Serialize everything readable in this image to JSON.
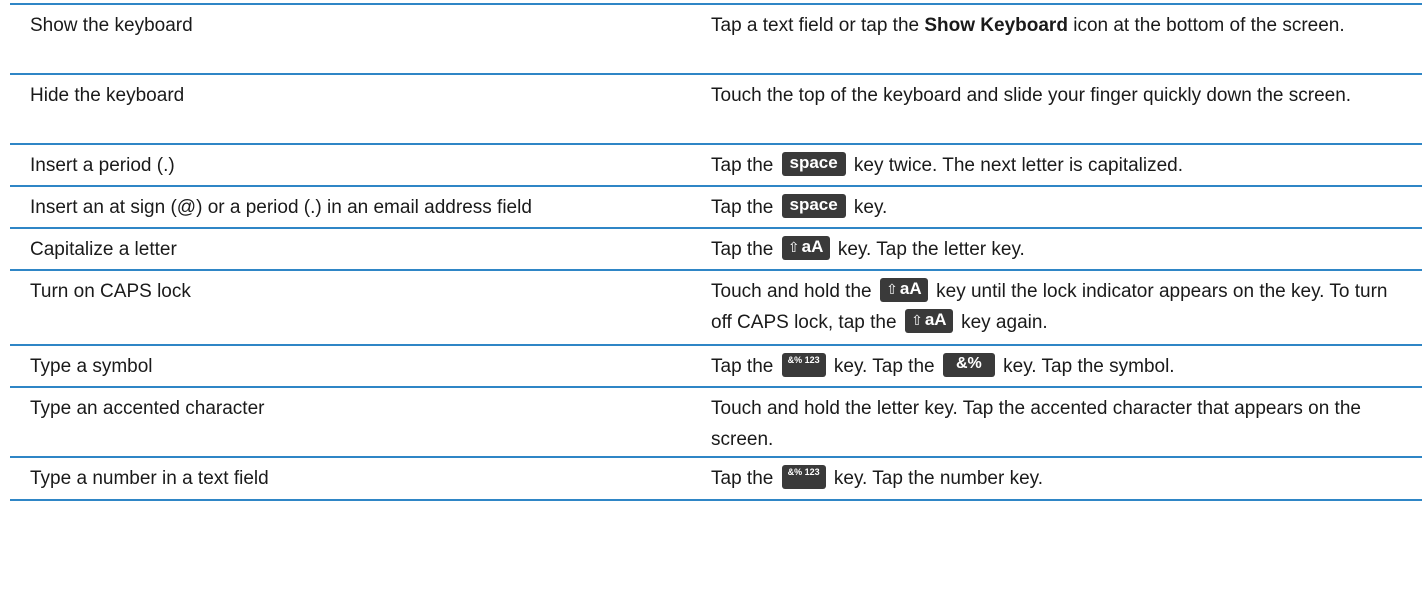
{
  "rows": [
    {
      "task": "Show the keyboard",
      "desc": {
        "a": "Tap a text field or tap the ",
        "b": "Show Keyboard",
        "c": " icon at the bottom of the screen."
      }
    },
    {
      "task": "Hide the keyboard",
      "desc": {
        "a": "Touch the top of the keyboard and slide your finger quickly down the screen."
      }
    },
    {
      "task": "Insert a period (.)",
      "desc": {
        "a": "Tap the ",
        "key": "space",
        "c": " key twice. The next letter is capitalized."
      }
    },
    {
      "task": "Insert an at sign (@) or a period (.) in an email address field",
      "desc": {
        "a": "Tap the ",
        "key": "space",
        "c": " key."
      }
    },
    {
      "task": "Capitalize a letter",
      "desc": {
        "a": "Tap the ",
        "key": "aA",
        "c": " key. Tap the letter key."
      }
    },
    {
      "task": "Turn on CAPS lock",
      "desc": {
        "a": "Touch and hold the ",
        "key": "aA",
        "c": " key until the lock indicator appears on the key. To turn off CAPS lock, tap the ",
        "key2": "aA",
        "e": " key again."
      }
    },
    {
      "task": "Type a symbol",
      "desc": {
        "a": "Tap the ",
        "key": "&% 123",
        "c": " key. Tap the ",
        "key2": "&%",
        "e": " key. Tap the symbol."
      }
    },
    {
      "task": "Type an accented character",
      "desc": {
        "a": "Touch and hold the letter key. Tap the accented character that appears on the screen."
      }
    },
    {
      "task": "Type a number in a text field",
      "desc": {
        "a": "Tap the ",
        "key": "&% 123",
        "c": " key. Tap the number key."
      }
    }
  ],
  "icons": {
    "shift_arrow": "shift-arrow-icon"
  }
}
